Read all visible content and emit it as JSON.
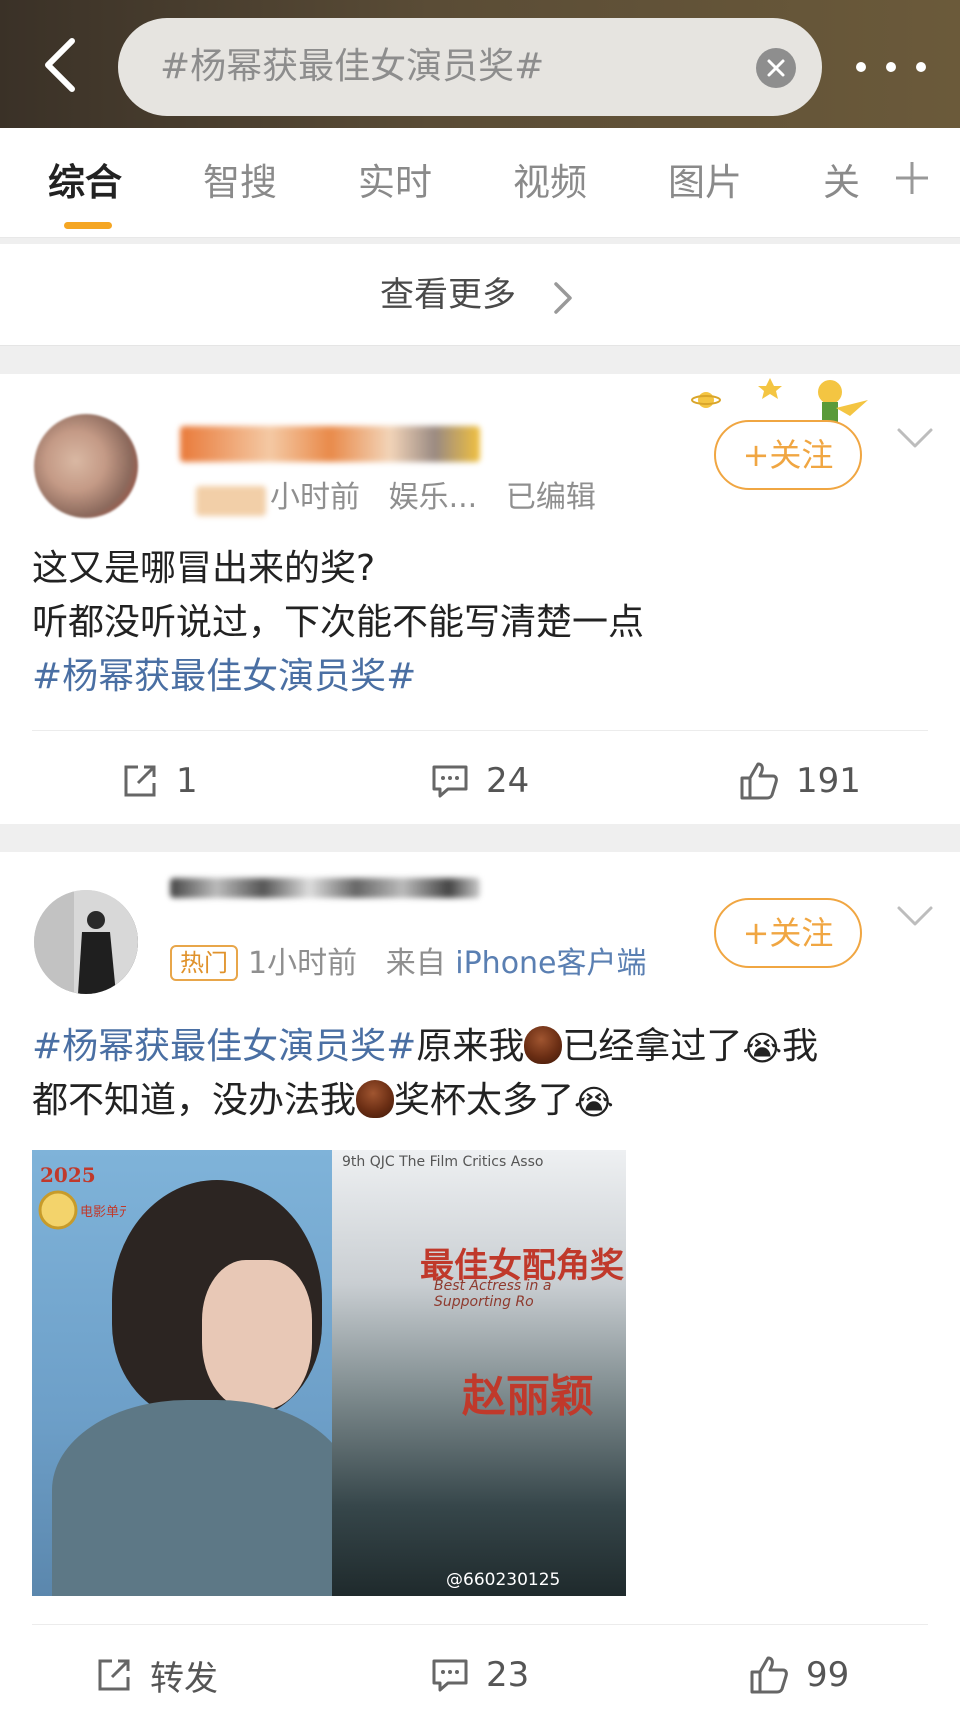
{
  "search": {
    "query": "#杨幂获最佳女演员奖#"
  },
  "tabs": [
    {
      "label": "综合"
    },
    {
      "label": "智搜"
    },
    {
      "label": "实时"
    },
    {
      "label": "视频"
    },
    {
      "label": "图片"
    },
    {
      "label": "关"
    }
  ],
  "see_more": {
    "label": "查看更多"
  },
  "posts": [
    {
      "meta_time": "小时前",
      "meta_source": "娱乐...",
      "meta_edited": "已编辑",
      "follow_label": "+关注",
      "text_line1": "这又是哪冒出来的奖?",
      "text_line2": "听都没听说过，下次能不能写清楚一点",
      "hashtag": "#杨幂获最佳女演员奖#",
      "repost_count": "1",
      "comment_count": "24",
      "like_count": "191"
    },
    {
      "hot_badge": "热门",
      "meta_time": "1小时前",
      "meta_from": "来自",
      "meta_source": "iPhone客户端",
      "follow_label": "+关注",
      "hashtag": "#杨幂获最佳女演员奖#",
      "text_a": "原来我",
      "text_b": "已经拿过了",
      "text_c": "我",
      "text_d": "都不知道，没办法我",
      "text_e": "奖杯太多了",
      "emoji_cry": "😭",
      "image": {
        "top_line": "9th QJC The Film Critics Asso",
        "award": "最佳女配角奖",
        "award_sub": "Best Actress in a Supporting Ro",
        "name": "赵丽颖",
        "watermark": "@660230125",
        "logo_year": "2025",
        "logo_text": "电影单元"
      },
      "repost_label": "转发",
      "comment_count": "23",
      "like_count": "99"
    }
  ],
  "colors": {
    "accent": "#f5a623",
    "follow": "#f0a642",
    "hashtag": "#4a6fa3"
  }
}
